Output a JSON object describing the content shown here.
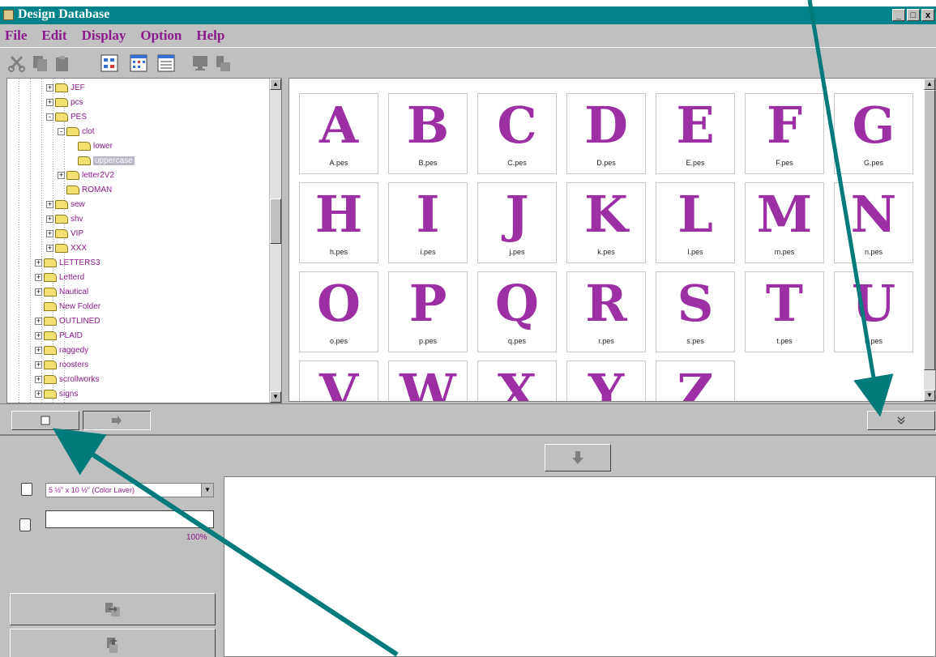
{
  "window": {
    "title": "Design Database",
    "controls": [
      "_",
      "□",
      "x"
    ]
  },
  "menu": {
    "items": [
      "File",
      "Edit",
      "Display",
      "Option",
      "Help"
    ]
  },
  "toolbar": {
    "buttons": [
      "cut-icon",
      "copy-icon",
      "paste-icon",
      "large-icons-icon",
      "small-icons-icon",
      "list-icon",
      "monitor-icon",
      "send-icon"
    ]
  },
  "tree": {
    "items": [
      {
        "label": "JEF",
        "depth": 3,
        "expander": "+"
      },
      {
        "label": "pcs",
        "depth": 3,
        "expander": "+"
      },
      {
        "label": "PES",
        "depth": 3,
        "expander": "-"
      },
      {
        "label": "clot",
        "depth": 4,
        "expander": "-"
      },
      {
        "label": "lower",
        "depth": 5,
        "expander": ""
      },
      {
        "label": "uppercase",
        "depth": 5,
        "expander": "",
        "selected": true
      },
      {
        "label": "letter2V2",
        "depth": 4,
        "expander": "+"
      },
      {
        "label": "ROMAN",
        "depth": 4,
        "expander": ""
      },
      {
        "label": "sew",
        "depth": 3,
        "expander": "+"
      },
      {
        "label": "shv",
        "depth": 3,
        "expander": "+"
      },
      {
        "label": "VIP",
        "depth": 3,
        "expander": "+"
      },
      {
        "label": "XXX",
        "depth": 3,
        "expander": "+"
      },
      {
        "label": "LETTERS3",
        "depth": 2,
        "expander": "+"
      },
      {
        "label": "Letterd",
        "depth": 2,
        "expander": "+"
      },
      {
        "label": "Nautical",
        "depth": 2,
        "expander": "+"
      },
      {
        "label": "New Folder",
        "depth": 2,
        "expander": ""
      },
      {
        "label": "OUTLINED",
        "depth": 2,
        "expander": "+"
      },
      {
        "label": "PLAID",
        "depth": 2,
        "expander": "+"
      },
      {
        "label": "raggedy",
        "depth": 2,
        "expander": "+"
      },
      {
        "label": "roosters",
        "depth": 2,
        "expander": "+"
      },
      {
        "label": "scrollworks",
        "depth": 2,
        "expander": "+"
      },
      {
        "label": "signs",
        "depth": 2,
        "expander": "+"
      }
    ]
  },
  "designs": [
    {
      "glyph": "A",
      "file": "A.pes"
    },
    {
      "glyph": "B",
      "file": "B.pes"
    },
    {
      "glyph": "C",
      "file": "C.pes"
    },
    {
      "glyph": "D",
      "file": "D.pes"
    },
    {
      "glyph": "E",
      "file": "E.pes"
    },
    {
      "glyph": "F",
      "file": "F.pes"
    },
    {
      "glyph": "G",
      "file": "G.pes"
    },
    {
      "glyph": "H",
      "file": "h.pes"
    },
    {
      "glyph": "I",
      "file": "i.pes"
    },
    {
      "glyph": "J",
      "file": "j.pes"
    },
    {
      "glyph": "K",
      "file": "k.pes"
    },
    {
      "glyph": "L",
      "file": "l.pes"
    },
    {
      "glyph": "M",
      "file": "m.pes"
    },
    {
      "glyph": "N",
      "file": "n.pes"
    },
    {
      "glyph": "O",
      "file": "o.pes"
    },
    {
      "glyph": "P",
      "file": "p.pes"
    },
    {
      "glyph": "Q",
      "file": "q.pes"
    },
    {
      "glyph": "R",
      "file": "r.pes"
    },
    {
      "glyph": "S",
      "file": "s.pes"
    },
    {
      "glyph": "T",
      "file": "t.pes"
    },
    {
      "glyph": "U",
      "file": "u.pes"
    },
    {
      "glyph": "V",
      "file": ""
    },
    {
      "glyph": "W",
      "file": ""
    },
    {
      "glyph": "X",
      "file": ""
    },
    {
      "glyph": "Y",
      "file": ""
    },
    {
      "glyph": "Z",
      "file": ""
    }
  ],
  "lower": {
    "hoop_select": "5 ½\" x 10 ½\" (Color Laver)",
    "zoom_percent": "100%",
    "name_field": ""
  },
  "colors": {
    "titlebar": "#00838a",
    "accent_text": "#8b1a8b",
    "glyph": "#9b2fa3",
    "arrow": "#007a7a"
  }
}
